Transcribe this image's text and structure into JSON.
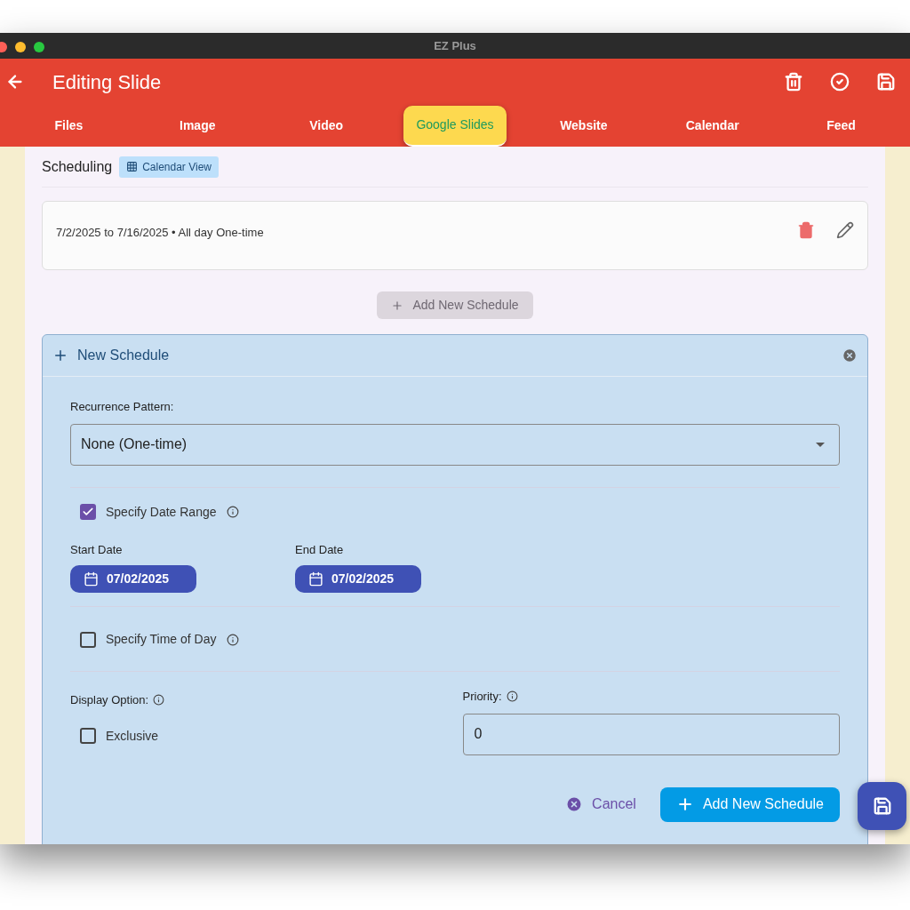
{
  "window": {
    "title": "EZ Plus"
  },
  "header": {
    "title": "Editing Slide"
  },
  "tabs": [
    {
      "label": "Files",
      "selected": false
    },
    {
      "label": "Image",
      "selected": false
    },
    {
      "label": "Video",
      "selected": false
    },
    {
      "label": "Google Slides",
      "selected": true
    },
    {
      "label": "Website",
      "selected": false
    },
    {
      "label": "Calendar",
      "selected": false
    },
    {
      "label": "Feed",
      "selected": false
    }
  ],
  "scheduling": {
    "title": "Scheduling",
    "calendar_view_button": "Calendar View"
  },
  "schedules": [
    {
      "text": "7/2/2025 to 7/16/2025 • All day One-time"
    }
  ],
  "add_schedule_button": {
    "label": "Add New Schedule",
    "disabled": true
  },
  "new_schedule": {
    "title": "New Schedule",
    "recurrence": {
      "label": "Recurrence Pattern:",
      "value": "None (One-time)"
    },
    "date_range": {
      "label": "Specify Date Range",
      "checked": true
    },
    "start_date": {
      "label": "Start Date",
      "value": "07/02/2025"
    },
    "end_date": {
      "label": "End Date",
      "value": "07/02/2025"
    },
    "time_of_day": {
      "label": "Specify Time of Day",
      "checked": false
    },
    "display_option": {
      "label": "Display Option:"
    },
    "exclusive": {
      "label": "Exclusive",
      "checked": false
    },
    "priority": {
      "label": "Priority:",
      "value": "0"
    },
    "cancel_button": "Cancel",
    "submit_button": "Add New Schedule"
  }
}
